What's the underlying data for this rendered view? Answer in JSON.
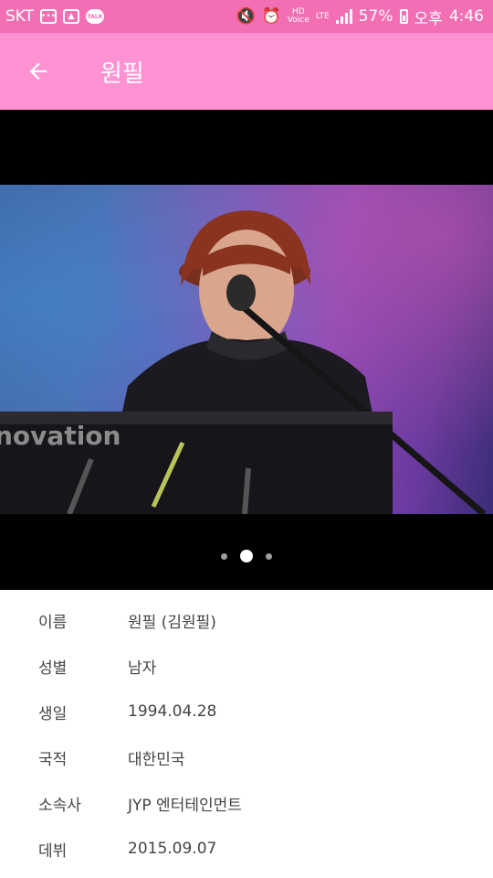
{
  "status_bar": {
    "carrier": "SKT",
    "hd_label": "HD",
    "voice_label": "Voice",
    "lte_label": "LTE",
    "battery_percent": "57%",
    "ampm": "오후",
    "time": "4:46",
    "talk_label": "TALK",
    "background": "#f26fb3"
  },
  "app_bar": {
    "title": "원필",
    "background": "#ff92d3"
  },
  "gallery": {
    "photo_text": "novation",
    "page_count": 3,
    "active_page": 2
  },
  "profile": {
    "rows": [
      {
        "label": "이름",
        "value": "원필 (김원필)"
      },
      {
        "label": "성별",
        "value": "남자"
      },
      {
        "label": "생일",
        "value": "1994.04.28"
      },
      {
        "label": "국적",
        "value": "대한민국"
      },
      {
        "label": "소속사",
        "value": "JYP 엔터테인먼트"
      },
      {
        "label": "데뷔",
        "value": "2015.09.07"
      }
    ]
  }
}
